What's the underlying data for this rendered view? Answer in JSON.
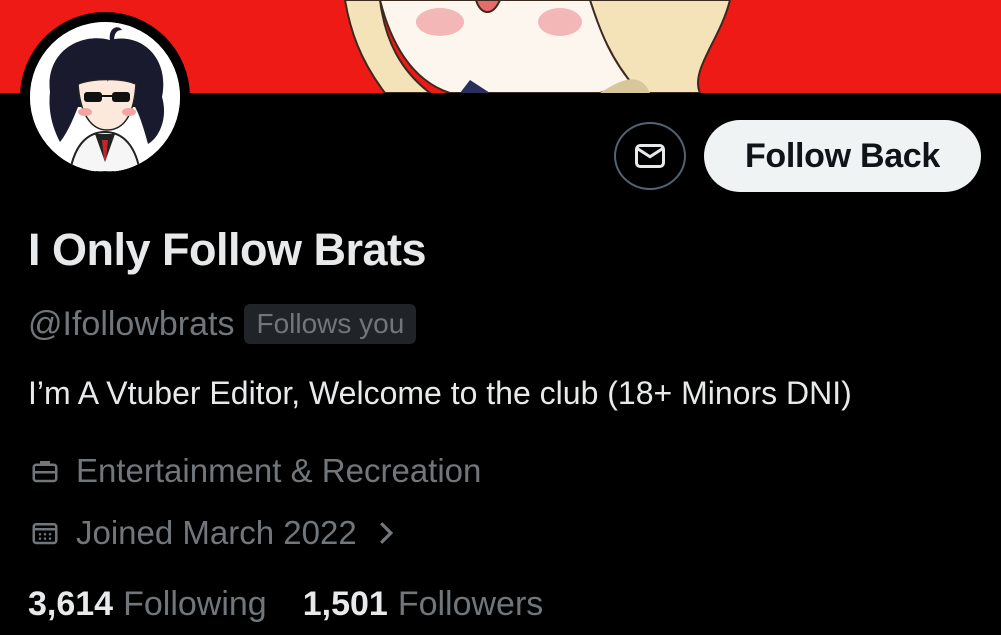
{
  "profile": {
    "display_name": "I Only Follow Brats",
    "handle": "@Ifollowbrats",
    "follows_you_badge": "Follows you",
    "bio": "I’m A Vtuber Editor, Welcome to the club (18+ Minors DNI)",
    "category": "Entertainment & Recreation",
    "joined": "Joined March 2022"
  },
  "actions": {
    "message_icon": "envelope-icon",
    "follow_back_label": "Follow Back"
  },
  "stats": {
    "following_count": "3,614",
    "following_label": "Following",
    "followers_count": "1,501",
    "followers_label": "Followers"
  },
  "colors": {
    "banner": "#ee1a16",
    "background": "#000000",
    "primary_text": "#e7e9ea",
    "secondary_text": "#71767b",
    "button_bg": "#eff3f4"
  }
}
